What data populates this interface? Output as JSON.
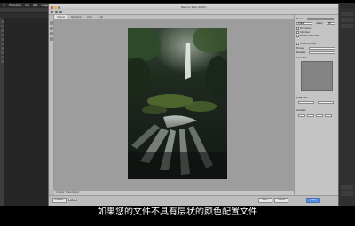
{
  "menubar": {
    "items": [
      "",
      "Photoshop",
      "File",
      "Edit",
      "Image",
      "Layer",
      "Type",
      "Select",
      "Filter",
      "3D",
      "View",
      "Window",
      "Help"
    ]
  },
  "dialog": {
    "title": "Save for Web (100%)",
    "tabs": [
      "Original",
      "Optimized",
      "2-Up",
      "4-Up"
    ],
    "active_tab": 0,
    "status_text": "Original: \"Waterfall.jpg\"",
    "zoom": "100%",
    "buttons": {
      "preview": "Preview...",
      "save": "Save...",
      "cancel": "Cancel",
      "done": "Done"
    },
    "settings": {
      "preset_label": "Preset:",
      "format_value": "JPEG",
      "quality_label": "Quality:",
      "quality_value": "60",
      "progressive_label": "Progressive",
      "optimized_label": "Optimized",
      "embed_profile_label": "Embed Color Profile",
      "convert_srgb_label": "Convert to sRGB",
      "preview_label": "Preview:",
      "metadata_label": "Metadata:",
      "color_table_label": "Color Table",
      "image_size_label": "Image Size",
      "animation_label": "Animation"
    }
  },
  "subtitle": "如果您的文件不具有层状的颜色配置文件",
  "colors": {
    "dialog_bg": "#b7b7b7",
    "preview_bg": "#9d9d9d",
    "accent_button": "#5b8fe0"
  }
}
